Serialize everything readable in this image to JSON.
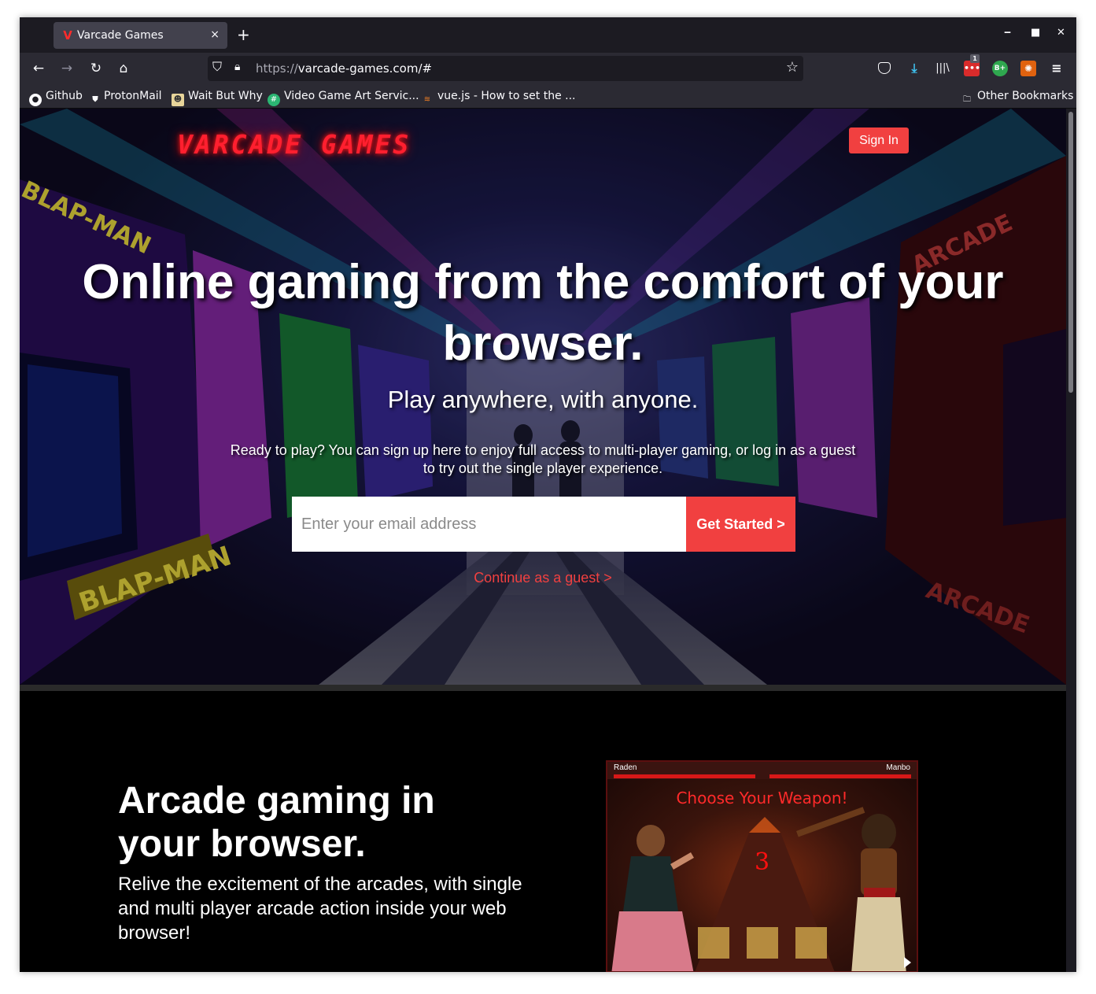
{
  "browser": {
    "tab_title": "Varcade Games",
    "tab_close": "×",
    "new_tab": "+",
    "url_prefix": "https://",
    "url_rest": "varcade-games.com/#",
    "extension_badge": "1",
    "ext_green_label": "B+"
  },
  "bookmarks": {
    "items": [
      {
        "label": "Github"
      },
      {
        "label": "ProtonMail"
      },
      {
        "label": "Wait But Why"
      },
      {
        "label": "Video Game Art Servic..."
      },
      {
        "label": "vue.js - How to set the ..."
      }
    ],
    "other": "Other Bookmarks"
  },
  "hero": {
    "logo": "VARCADE GAMES",
    "signin": "Sign In",
    "headline": "Online gaming from the comfort of your browser.",
    "subheadline": "Play anywhere, with anyone.",
    "ready_text": "Ready to play? You can sign up here to enjoy full access to multi-player gaming, or log in as a guest to try out the single player experience.",
    "email_placeholder": "Enter your email address",
    "get_started": "Get Started >",
    "guest_link": "Continue as a guest >"
  },
  "section2": {
    "title": "Arcade gaming in your browser.",
    "body": "Relive the excitement of the arcades, with single and multi player arcade action inside your web browser!"
  },
  "game": {
    "player1": "Raden",
    "player2": "Manbo",
    "banner": "Choose Your Weapon!",
    "countdown": "3"
  },
  "colors": {
    "accent": "#f14040",
    "browser_bg": "#1c1b22",
    "toolbar_bg": "#2b2a33"
  }
}
